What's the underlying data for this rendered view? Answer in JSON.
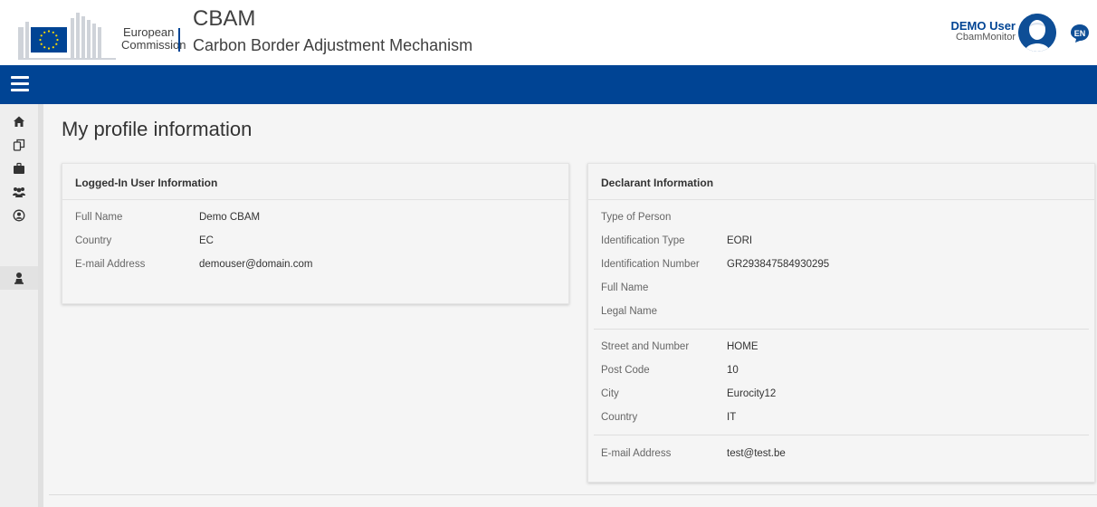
{
  "header": {
    "logo_line1": "European",
    "logo_line2": "Commission",
    "app_title": "CBAM",
    "app_subtitle": "Carbon Border Adjustment Mechanism",
    "user_name": "DEMO User",
    "user_role": "CbamMonitor",
    "language": "EN"
  },
  "sidebar": {
    "items": [
      {
        "icon": "home-icon"
      },
      {
        "icon": "documents-icon"
      },
      {
        "icon": "briefcase-icon"
      },
      {
        "icon": "users-icon"
      },
      {
        "icon": "account-circle-icon"
      },
      {
        "icon": "user-icon",
        "active": true
      }
    ]
  },
  "main": {
    "page_title": "My profile information",
    "user_card": {
      "title": "Logged-In User Information",
      "fields": [
        {
          "label": "Full Name",
          "value": "Demo CBAM"
        },
        {
          "label": "Country",
          "value": "EC"
        },
        {
          "label": "E-mail Address",
          "value": "demouser@domain.com"
        }
      ]
    },
    "declarant_card": {
      "title": "Declarant Information",
      "identity_fields": [
        {
          "label": "Type of Person",
          "value": ""
        },
        {
          "label": "Identification Type",
          "value": "EORI"
        },
        {
          "label": "Identification Number",
          "value": "GR293847584930295"
        },
        {
          "label": "Full Name",
          "value": ""
        },
        {
          "label": "Legal Name",
          "value": ""
        }
      ],
      "address_fields": [
        {
          "label": "Street and Number",
          "value": "HOME"
        },
        {
          "label": "Post Code",
          "value": "10"
        },
        {
          "label": "City",
          "value": "Eurocity12"
        },
        {
          "label": "Country",
          "value": "IT"
        }
      ],
      "contact_fields": [
        {
          "label": "E-mail Address",
          "value": "test@test.be"
        }
      ]
    }
  },
  "colors": {
    "brand_blue": "#004494",
    "flag_yellow": "#ffdd00",
    "background": "#f5f5f5"
  }
}
